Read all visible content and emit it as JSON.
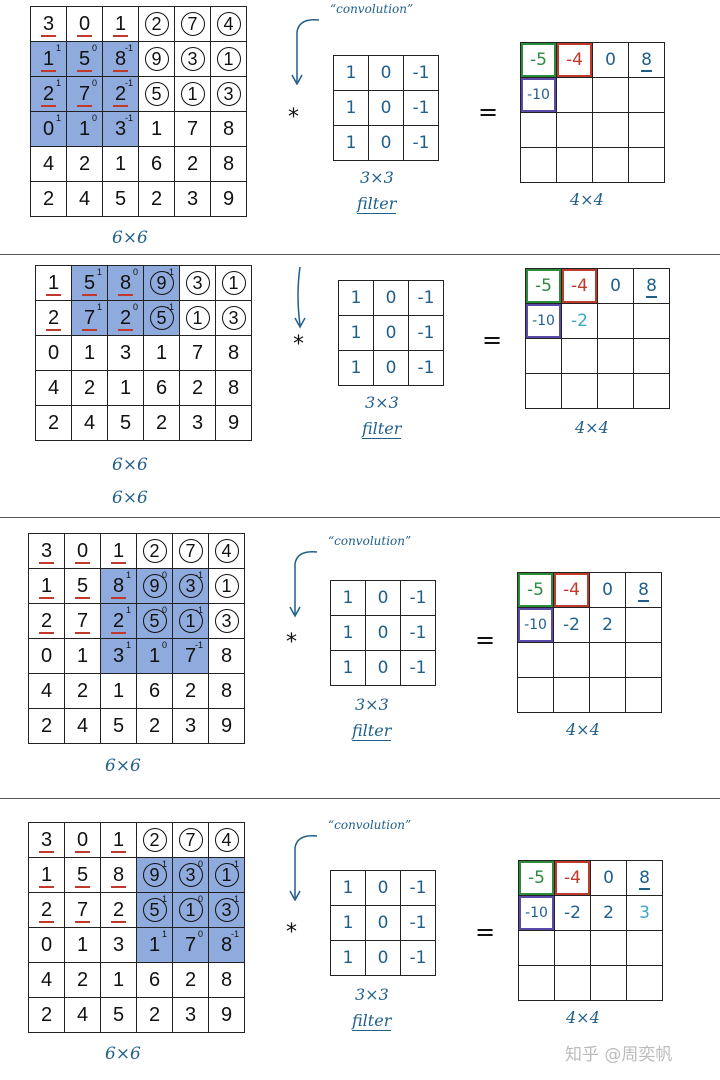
{
  "labels": {
    "convolution": "“convolution”",
    "input_size": "6×6",
    "filter_size": "3×3",
    "filter_word": "filter",
    "output_size": "4×4",
    "conv_op": "*",
    "equals": "="
  },
  "input_values": [
    [
      3,
      0,
      1,
      2,
      7,
      4
    ],
    [
      1,
      5,
      8,
      9,
      3,
      1
    ],
    [
      2,
      7,
      2,
      5,
      1,
      3
    ],
    [
      0,
      1,
      3,
      1,
      7,
      8
    ],
    [
      4,
      2,
      1,
      6,
      2,
      8
    ],
    [
      2,
      4,
      5,
      2,
      3,
      9
    ]
  ],
  "filter_values": [
    [
      "1",
      "0",
      "-1"
    ],
    [
      "1",
      "0",
      "-1"
    ],
    [
      "1",
      "0",
      "-1"
    ]
  ],
  "panels": [
    {
      "id": "step1",
      "highlight": {
        "row": 1,
        "col": 0
      },
      "show_top_row": true,
      "show_conv_label": true,
      "output": [
        "-5",
        "-4",
        "0",
        "8",
        "-10",
        "",
        "",
        "",
        "",
        "",
        "",
        "",
        "",
        "",
        "",
        ""
      ]
    },
    {
      "id": "step2",
      "highlight": {
        "row": 0,
        "col": 1
      },
      "show_top_row": false,
      "show_conv_label": false,
      "output": [
        "-5",
        "-4",
        "0",
        "8",
        "-10",
        "-2",
        "",
        "",
        "",
        "",
        "",
        "",
        "",
        "",
        "",
        ""
      ]
    },
    {
      "id": "step3",
      "highlight": {
        "row": 1,
        "col": 2
      },
      "show_top_row": true,
      "show_conv_label": true,
      "output": [
        "-5",
        "-4",
        "0",
        "8",
        "-10",
        "-2",
        "2",
        "",
        "",
        "",
        "",
        "",
        "",
        "",
        "",
        ""
      ]
    },
    {
      "id": "step4",
      "highlight": {
        "row": 1,
        "col": 3
      },
      "show_top_row": true,
      "show_conv_label": true,
      "output": [
        "-5",
        "-4",
        "0",
        "8",
        "-10",
        "-2",
        "2",
        "3",
        "",
        "",
        "",
        "",
        "",
        "",
        "",
        ""
      ]
    }
  ],
  "watermark": "知乎 @周奕帆",
  "colors": {
    "highlight": "#8faadc",
    "ink": "#1f5f8b",
    "green": "#2e8b3e",
    "red": "#c0392b",
    "purple": "#5b4aa8"
  }
}
